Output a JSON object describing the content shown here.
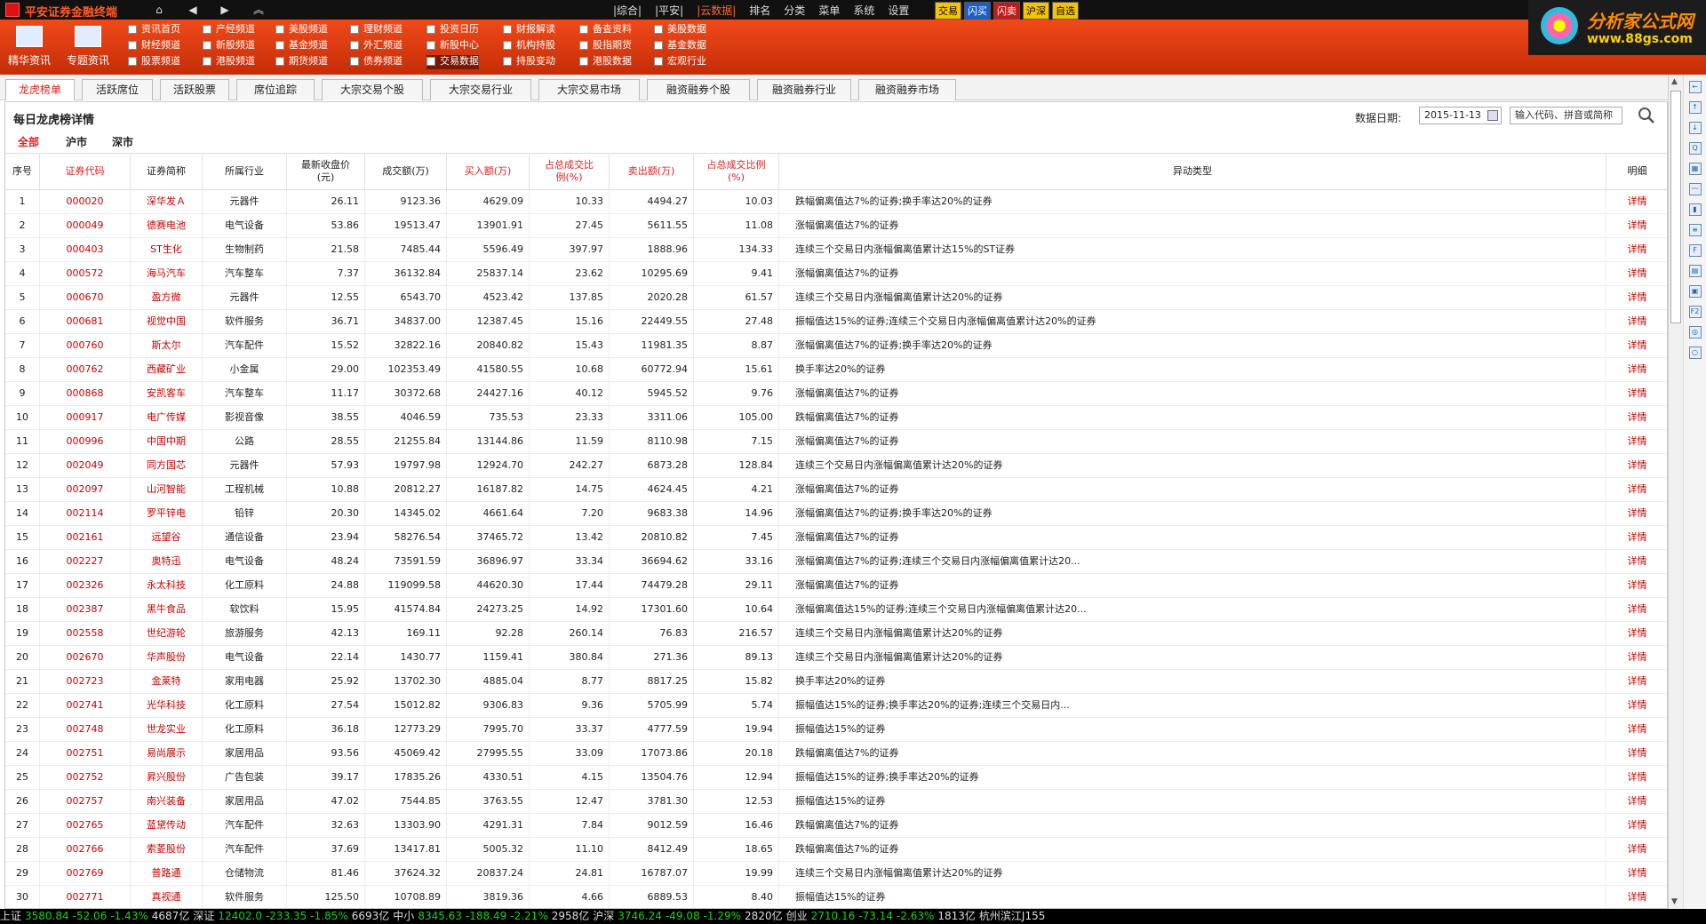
{
  "app": {
    "title": "平安证券金融终端",
    "menu": [
      "|综合|",
      "|平安|",
      "|云数据|",
      "排名",
      "分类",
      "菜单",
      "系统",
      "设置"
    ],
    "active_menu": 2,
    "quick": [
      "交易",
      "闪买",
      "闪卖",
      "沪深",
      "自选"
    ]
  },
  "brand": {
    "name": "分析家公式网",
    "url": "www.88gs.com"
  },
  "ribbon": {
    "big": [
      "精华资讯",
      "专题资讯"
    ],
    "cols": [
      [
        "资讯首页",
        "财经频道",
        "股票频道"
      ],
      [
        "产经频道",
        "新股频道",
        "港股频道"
      ],
      [
        "美股频道",
        "基金频道",
        "期货频道"
      ],
      [
        "理财频道",
        "外汇频道",
        "债券频道"
      ],
      [
        "投资日历",
        "新股中心",
        "交易数据"
      ],
      [
        "财报解读",
        "机构持股",
        "持股变动"
      ],
      [
        "备查资料",
        "股指期货",
        "港股数据"
      ],
      [
        "美股数据",
        "基金数据",
        "宏观行业"
      ]
    ]
  },
  "tabs": [
    "龙虎榜单",
    "活跃席位",
    "活跃股票",
    "席位追踪",
    "大宗交易个股",
    "大宗交易行业",
    "大宗交易市场",
    "融资融券个股",
    "融资融券行业",
    "融资融券市场"
  ],
  "page": {
    "title": "每日龙虎榜详情",
    "date_label": "数据日期:",
    "date_value": "2015-11-13",
    "search_placeholder": "输入代码、拼音或简称",
    "market_tabs": [
      "全部",
      "沪市",
      "深市"
    ]
  },
  "table": {
    "columns": [
      "序号",
      "证券代码",
      "证券简称",
      "所属行业",
      "最新收盘价(元)",
      "成交额(万)",
      "买入额(万)",
      "占总成交比例(%)",
      "卖出额(万)",
      "占总成交比例(%)",
      "异动类型",
      "明细"
    ],
    "detail_label": "详情",
    "rows": [
      [
        "1",
        "000020",
        "深华发Ａ",
        "元器件",
        "26.11",
        "9123.36",
        "4629.09",
        "10.33",
        "4494.27",
        "10.03",
        "跌幅偏离值达7%的证券;换手率达20%的证券"
      ],
      [
        "2",
        "000049",
        "德赛电池",
        "电气设备",
        "53.86",
        "19513.47",
        "13901.91",
        "27.45",
        "5611.55",
        "11.08",
        "涨幅偏离值达7%的证券"
      ],
      [
        "3",
        "000403",
        "ST生化",
        "生物制药",
        "21.58",
        "7485.44",
        "5596.49",
        "397.97",
        "1888.96",
        "134.33",
        "连续三个交易日内涨幅偏离值累计达15%的ST证券"
      ],
      [
        "4",
        "000572",
        "海马汽车",
        "汽车整车",
        "7.37",
        "36132.84",
        "25837.14",
        "23.62",
        "10295.69",
        "9.41",
        "涨幅偏离值达7%的证券"
      ],
      [
        "5",
        "000670",
        "盈方微",
        "元器件",
        "12.55",
        "6543.70",
        "4523.42",
        "137.85",
        "2020.28",
        "61.57",
        "连续三个交易日内涨幅偏离值累计达20%的证券"
      ],
      [
        "6",
        "000681",
        "视觉中国",
        "软件服务",
        "36.71",
        "34837.00",
        "12387.45",
        "15.16",
        "22449.55",
        "27.48",
        "振幅值达15%的证券;连续三个交易日内涨幅偏离值累计达20%的证券"
      ],
      [
        "7",
        "000760",
        "斯太尔",
        "汽车配件",
        "15.52",
        "32822.16",
        "20840.82",
        "15.43",
        "11981.35",
        "8.87",
        "涨幅偏离值达7%的证券;换手率达20%的证券"
      ],
      [
        "8",
        "000762",
        "西藏矿业",
        "小金属",
        "29.00",
        "102353.49",
        "41580.55",
        "10.68",
        "60772.94",
        "15.61",
        "换手率达20%的证券"
      ],
      [
        "9",
        "000868",
        "安凯客车",
        "汽车整车",
        "11.17",
        "30372.68",
        "24427.16",
        "40.12",
        "5945.52",
        "9.76",
        "涨幅偏离值达7%的证券"
      ],
      [
        "10",
        "000917",
        "电广传媒",
        "影视音像",
        "38.55",
        "4046.59",
        "735.53",
        "23.33",
        "3311.06",
        "105.00",
        "跌幅偏离值达7%的证券"
      ],
      [
        "11",
        "000996",
        "中国中期",
        "公路",
        "28.55",
        "21255.84",
        "13144.86",
        "11.59",
        "8110.98",
        "7.15",
        "涨幅偏离值达7%的证券"
      ],
      [
        "12",
        "002049",
        "同方国芯",
        "元器件",
        "57.93",
        "19797.98",
        "12924.70",
        "242.27",
        "6873.28",
        "128.84",
        "连续三个交易日内涨幅偏离值累计达20%的证券"
      ],
      [
        "13",
        "002097",
        "山河智能",
        "工程机械",
        "10.88",
        "20812.27",
        "16187.82",
        "14.75",
        "4624.45",
        "4.21",
        "涨幅偏离值达7%的证券"
      ],
      [
        "14",
        "002114",
        "罗平锌电",
        "铅锌",
        "20.30",
        "14345.02",
        "4661.64",
        "7.20",
        "9683.38",
        "14.96",
        "涨幅偏离值达7%的证券;换手率达20%的证券"
      ],
      [
        "15",
        "002161",
        "远望谷",
        "通信设备",
        "23.94",
        "58276.54",
        "37465.72",
        "13.42",
        "20810.82",
        "7.45",
        "涨幅偏离值达7%的证券"
      ],
      [
        "16",
        "002227",
        "奥特迅",
        "电气设备",
        "48.24",
        "73591.59",
        "36896.97",
        "33.34",
        "36694.62",
        "33.16",
        "涨幅偏离值达7%的证券;连续三个交易日内涨幅偏离值累计达20..."
      ],
      [
        "17",
        "002326",
        "永太科技",
        "化工原料",
        "24.88",
        "119099.58",
        "44620.30",
        "17.44",
        "74479.28",
        "29.11",
        "涨幅偏离值达7%的证券"
      ],
      [
        "18",
        "002387",
        "黑牛食品",
        "软饮料",
        "15.95",
        "41574.84",
        "24273.25",
        "14.92",
        "17301.60",
        "10.64",
        "涨幅偏离值达15%的证券;连续三个交易日内涨幅偏离值累计达20..."
      ],
      [
        "19",
        "002558",
        "世纪游轮",
        "旅游服务",
        "42.13",
        "169.11",
        "92.28",
        "260.14",
        "76.83",
        "216.57",
        "连续三个交易日内涨幅偏离值累计达20%的证券"
      ],
      [
        "20",
        "002670",
        "华声股份",
        "电气设备",
        "22.14",
        "1430.77",
        "1159.41",
        "380.84",
        "271.36",
        "89.13",
        "连续三个交易日内涨幅偏离值累计达20%的证券"
      ],
      [
        "21",
        "002723",
        "金莱特",
        "家用电器",
        "25.92",
        "13702.30",
        "4885.04",
        "8.77",
        "8817.25",
        "15.82",
        "换手率达20%的证券"
      ],
      [
        "22",
        "002741",
        "光华科技",
        "化工原料",
        "27.54",
        "15012.82",
        "9306.83",
        "9.36",
        "5705.99",
        "5.74",
        "振幅值达15%的证券;换手率达20%的证券;连续三个交易日内..."
      ],
      [
        "23",
        "002748",
        "世龙实业",
        "化工原料",
        "36.18",
        "12773.29",
        "7995.70",
        "33.37",
        "4777.59",
        "19.94",
        "振幅值达15%的证券"
      ],
      [
        "24",
        "002751",
        "易尚展示",
        "家居用品",
        "93.56",
        "45069.42",
        "27995.55",
        "33.09",
        "17073.86",
        "20.18",
        "跌幅偏离值达7%的证券"
      ],
      [
        "25",
        "002752",
        "昇兴股份",
        "广告包装",
        "39.17",
        "17835.26",
        "4330.51",
        "4.15",
        "13504.76",
        "12.94",
        "振幅值达15%的证券;换手率达20%的证券"
      ],
      [
        "26",
        "002757",
        "南兴装备",
        "家居用品",
        "47.02",
        "7544.85",
        "3763.55",
        "12.47",
        "3781.30",
        "12.53",
        "振幅值达15%的证券"
      ],
      [
        "27",
        "002765",
        "蓝黛传动",
        "汽车配件",
        "32.63",
        "13303.90",
        "4291.31",
        "7.84",
        "9012.59",
        "16.46",
        "跌幅偏离值达7%的证券"
      ],
      [
        "28",
        "002766",
        "索菱股份",
        "汽车配件",
        "37.69",
        "13417.81",
        "5005.32",
        "11.10",
        "8412.49",
        "18.65",
        "跌幅偏离值达7%的证券"
      ],
      [
        "29",
        "002769",
        "普路通",
        "仓储物流",
        "81.46",
        "37624.32",
        "20837.24",
        "24.81",
        "16787.07",
        "19.99",
        "连续三个交易日内涨幅偏离值累计达20%的证券"
      ],
      [
        "30",
        "002771",
        "真视通",
        "软件服务",
        "125.50",
        "10708.89",
        "3819.36",
        "4.66",
        "6889.53",
        "8.40",
        "振幅值达15%的证券"
      ]
    ]
  },
  "status": [
    {
      "t": "上证",
      "c": "w"
    },
    {
      "t": "3580.84",
      "c": "g"
    },
    {
      "t": "-52.06",
      "c": "g"
    },
    {
      "t": "-1.43%",
      "c": "g"
    },
    {
      "t": "4687亿",
      "c": "w"
    },
    {
      "t": "深证",
      "c": "w"
    },
    {
      "t": "12402.0",
      "c": "g"
    },
    {
      "t": "-233.35",
      "c": "g"
    },
    {
      "t": "-1.85%",
      "c": "g"
    },
    {
      "t": "6693亿",
      "c": "w"
    },
    {
      "t": "中小",
      "c": "w"
    },
    {
      "t": "8345.63",
      "c": "g"
    },
    {
      "t": "-188.49",
      "c": "g"
    },
    {
      "t": "-2.21%",
      "c": "g"
    },
    {
      "t": "2958亿",
      "c": "w"
    },
    {
      "t": "沪深",
      "c": "w"
    },
    {
      "t": "3746.24",
      "c": "g"
    },
    {
      "t": "-49.08",
      "c": "g"
    },
    {
      "t": "-1.29%",
      "c": "g"
    },
    {
      "t": "2820亿",
      "c": "w"
    },
    {
      "t": "创业",
      "c": "w"
    },
    {
      "t": "2710.16",
      "c": "g"
    },
    {
      "t": "-73.14",
      "c": "g"
    },
    {
      "t": "-2.63%",
      "c": "g"
    },
    {
      "t": "1813亿",
      "c": "w"
    },
    {
      "t": "杭州滨江J155",
      "c": "w"
    }
  ],
  "colors": {
    "ribbon": "#e0400f",
    "accent_red": "#d22222",
    "up": "#ff3b3b",
    "down": "#19d019"
  }
}
